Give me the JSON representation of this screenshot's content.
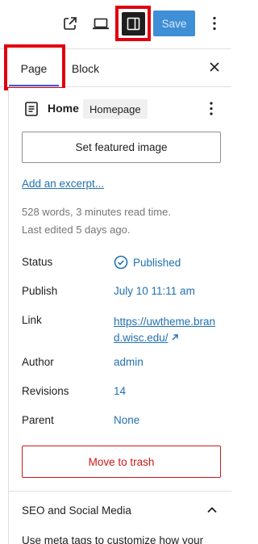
{
  "toolbar": {
    "view_external_icon": "external-link-icon",
    "preview_icon": "laptop-icon",
    "settings_icon": "sidebar-panel-icon",
    "save_label": "Save",
    "more_icon": "vertical-ellipsis-icon"
  },
  "tabs": {
    "page_label": "Page",
    "block_label": "Block",
    "close_icon": "close-icon"
  },
  "page": {
    "icon": "page-document-icon",
    "title": "Home",
    "badge": "Homepage",
    "more_icon": "vertical-ellipsis-icon",
    "featured_image_label": "Set featured image",
    "excerpt_link": "Add an excerpt...",
    "word_count": "528 words, 3 minutes read time.",
    "last_edited": "Last edited 5 days ago."
  },
  "summary": {
    "status_label": "Status",
    "status_value": "Published",
    "status_icon": "check-circle-icon",
    "publish_label": "Publish",
    "publish_value": "July 10 11:11 am",
    "link_label": "Link",
    "link_value": "https://uwtheme.brand.wisc.edu/",
    "link_arrow_icon": "arrow-up-right-icon",
    "author_label": "Author",
    "author_value": "admin",
    "revisions_label": "Revisions",
    "revisions_value": "14",
    "parent_label": "Parent",
    "parent_value": "None"
  },
  "trash_label": "Move to trash",
  "seo": {
    "title": "SEO and Social Media",
    "chevron_icon": "chevron-up-icon",
    "description": "Use meta tags to customize how your"
  },
  "colors": {
    "accent": "#3858e9",
    "link": "#2271b1",
    "danger": "#cc1818",
    "highlight_box": "#e0000f",
    "save_button": "#3f8fd6"
  }
}
